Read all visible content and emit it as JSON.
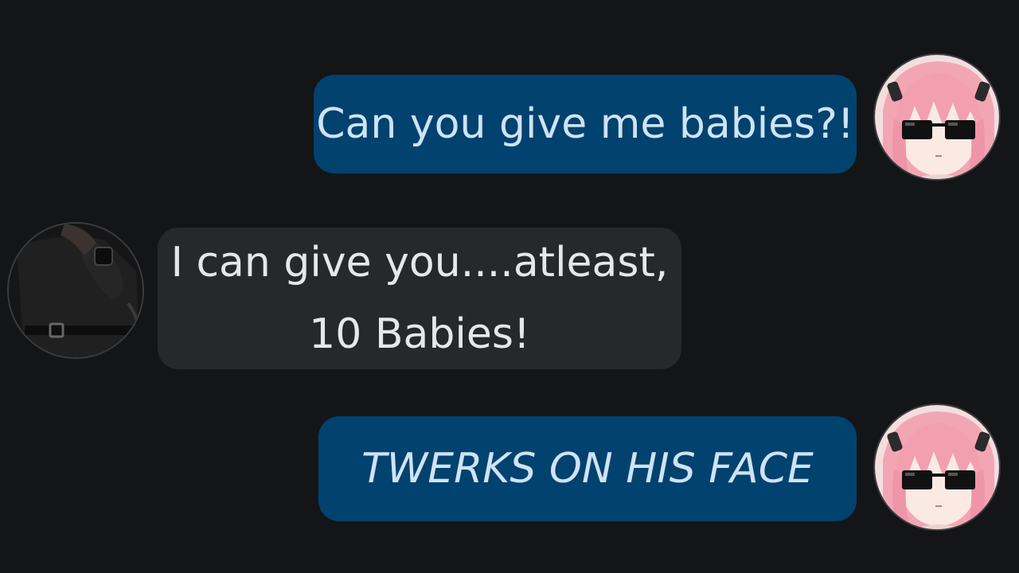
{
  "conversation": {
    "messages": [
      {
        "side": "sent",
        "text": "Can you give me babies?!"
      },
      {
        "side": "received",
        "line1": "I can give you....atleast,",
        "line2": "10 Babies!"
      },
      {
        "side": "sent",
        "text": "TWERKS ON HIS FACE"
      }
    ],
    "avatars": {
      "girl": "pink-haired-girl-with-sunglasses",
      "man": "man-in-black-shirt-with-watch"
    }
  },
  "colors": {
    "background": "#141517",
    "sent_bubble": "#02426f",
    "received_bubble": "#26282c"
  }
}
